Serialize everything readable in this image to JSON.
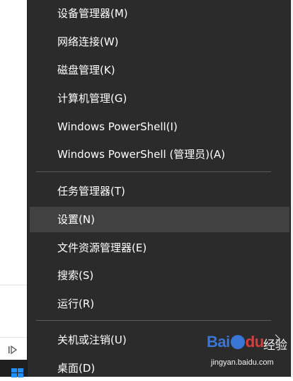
{
  "menu": {
    "items": [
      {
        "label": "设备管理器(M)",
        "name": "menu-item-device-manager"
      },
      {
        "label": "网络连接(W)",
        "name": "menu-item-network-connections"
      },
      {
        "label": "磁盘管理(K)",
        "name": "menu-item-disk-management"
      },
      {
        "label": "计算机管理(G)",
        "name": "menu-item-computer-management"
      },
      {
        "label": "Windows PowerShell(I)",
        "name": "menu-item-powershell"
      },
      {
        "label": "Windows PowerShell (管理员)(A)",
        "name": "menu-item-powershell-admin"
      },
      {
        "label": "任务管理器(T)",
        "name": "menu-item-task-manager"
      },
      {
        "label": "设置(N)",
        "name": "menu-item-settings"
      },
      {
        "label": "文件资源管理器(E)",
        "name": "menu-item-file-explorer"
      },
      {
        "label": "搜索(S)",
        "name": "menu-item-search"
      },
      {
        "label": "运行(R)",
        "name": "menu-item-run"
      },
      {
        "label": "关机或注销(U)",
        "name": "menu-item-shutdown-signout"
      },
      {
        "label": "桌面(D)",
        "name": "menu-item-desktop"
      }
    ],
    "highlighted": "设置(N)"
  },
  "watermark": {
    "logo_text_1": "Bai",
    "logo_text_2": "du",
    "cn_text": "经验",
    "url": "jingyan.baidu.com"
  },
  "colors": {
    "menu_bg": "#2b2b2b",
    "highlight_bg": "#414141",
    "separator": "#5a5a5a",
    "text": "#ffffff",
    "windows_blue": "#1e90ff"
  },
  "icons": {
    "submenu_arrow": "chevron-right-icon",
    "windows_logo": "windows-logo-icon",
    "playbar": "step-play-icon"
  }
}
